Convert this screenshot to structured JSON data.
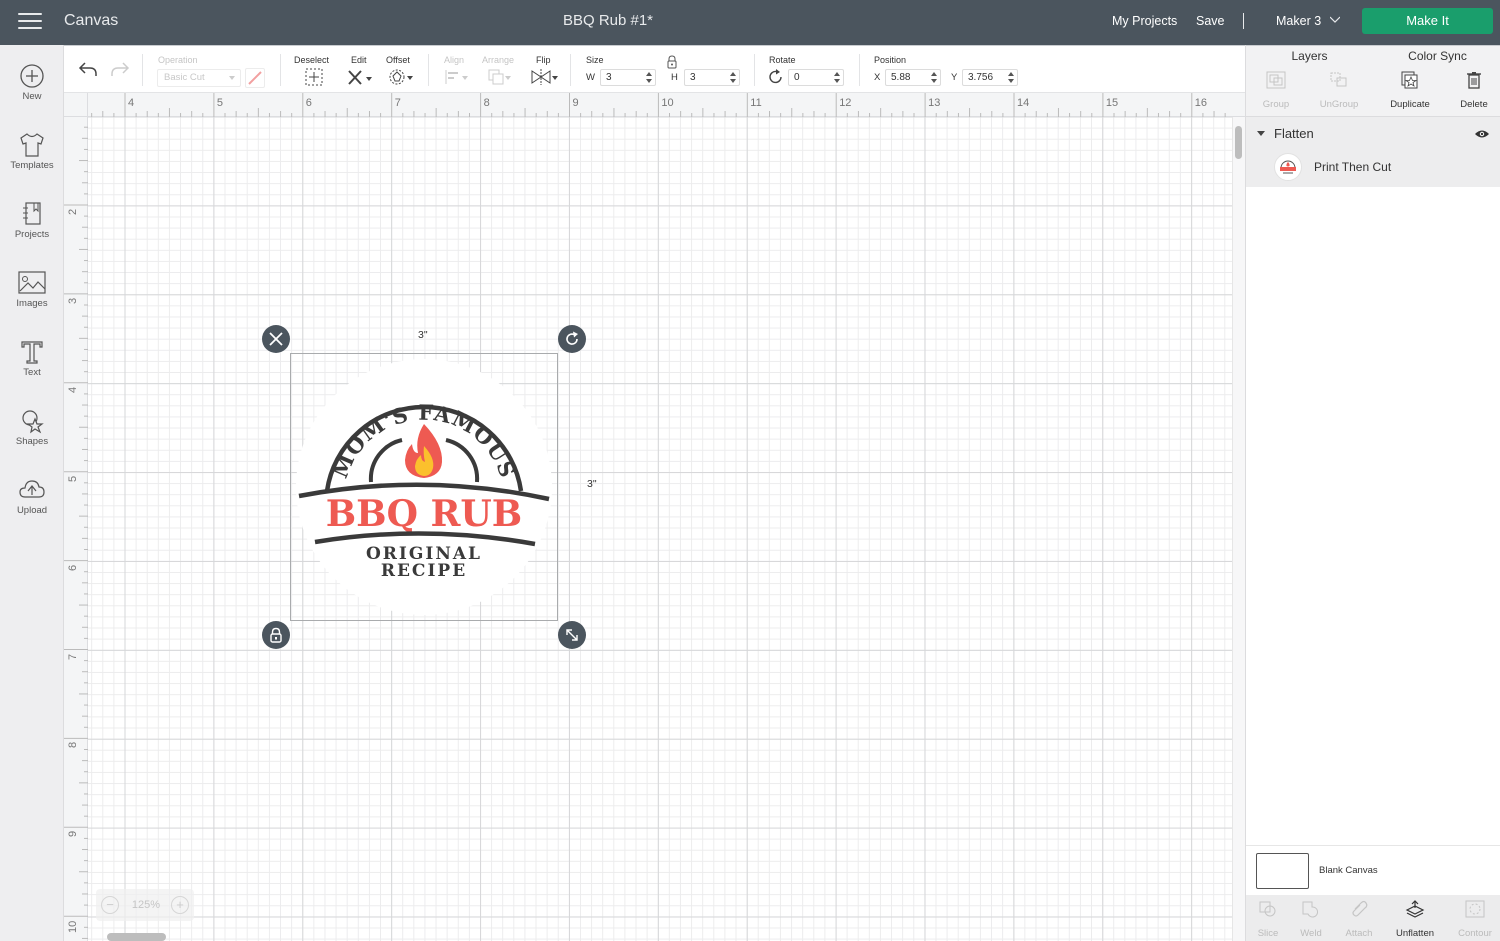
{
  "header": {
    "app_title": "Canvas",
    "document_title": "BBQ Rub #1*",
    "my_projects": "My Projects",
    "save": "Save",
    "machine": "Maker 3",
    "make_it": "Make It",
    "accent_color": "#1a9e6c"
  },
  "sidebar": {
    "items": [
      {
        "label": "New",
        "icon": "plus-circle-icon"
      },
      {
        "label": "Templates",
        "icon": "tshirt-icon"
      },
      {
        "label": "Projects",
        "icon": "notebook-icon"
      },
      {
        "label": "Images",
        "icon": "image-icon"
      },
      {
        "label": "Text",
        "icon": "text-icon"
      },
      {
        "label": "Shapes",
        "icon": "shapes-icon"
      },
      {
        "label": "Upload",
        "icon": "cloud-upload-icon"
      }
    ]
  },
  "toolbar": {
    "operation_label": "Operation",
    "operation_value": "Basic Cut",
    "deselect": "Deselect",
    "edit": "Edit",
    "offset": "Offset",
    "align": "Align",
    "arrange": "Arrange",
    "flip": "Flip",
    "size": "Size",
    "w_letter": "W",
    "w_value": "3",
    "h_letter": "H",
    "h_value": "3",
    "rotate": "Rotate",
    "rotate_value": "0",
    "position": "Position",
    "x_letter": "X",
    "x_value": "5.88",
    "y_letter": "Y",
    "y_value": "3.756"
  },
  "rulers": {
    "horizontal": [
      "4",
      "5",
      "6",
      "7",
      "8",
      "9",
      "10",
      "11",
      "12",
      "13",
      "14",
      "15",
      "16"
    ],
    "vertical": [
      "2",
      "3",
      "4",
      "5",
      "6",
      "7",
      "8",
      "9",
      "10"
    ]
  },
  "canvas": {
    "width_label": "3\"",
    "height_label": "3\"",
    "zoom_level": "125%",
    "design": {
      "arc_text": "MOM'S FAMOUS",
      "main_text": "BBQ RUB",
      "sub_line1": "ORIGINAL",
      "sub_line2": "RECIPE",
      "main_color": "#ee5a52",
      "dark_color": "#3a3a3a"
    }
  },
  "panel": {
    "tabs": [
      "Layers",
      "Color Sync"
    ],
    "actions": [
      {
        "label": "Group",
        "enabled": false
      },
      {
        "label": "UnGroup",
        "enabled": false
      },
      {
        "label": "Duplicate",
        "enabled": true
      },
      {
        "label": "Delete",
        "enabled": true
      }
    ],
    "group_name": "Flatten",
    "layer_name": "Print Then Cut",
    "blank_canvas": "Blank Canvas",
    "bottom_actions": [
      {
        "label": "Slice",
        "enabled": false
      },
      {
        "label": "Weld",
        "enabled": false
      },
      {
        "label": "Attach",
        "enabled": false
      },
      {
        "label": "Unflatten",
        "enabled": true
      },
      {
        "label": "Contour",
        "enabled": false
      }
    ]
  }
}
